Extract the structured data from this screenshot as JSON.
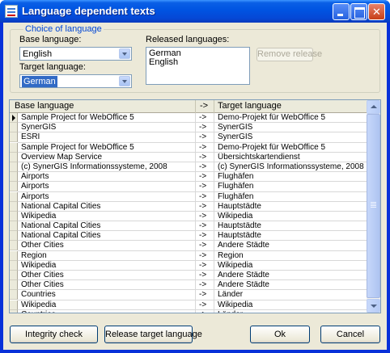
{
  "window": {
    "title": "Language dependent texts",
    "controls": {
      "minimize": "minimize",
      "maximize": "maximize",
      "close": "✕"
    }
  },
  "choice": {
    "legend": "Choice of language",
    "base_label": "Base language:",
    "base_value": "English",
    "target_label": "Target language:",
    "target_value": "German",
    "released_label": "Released languages:",
    "released": [
      "German",
      "English"
    ],
    "remove_release": "Remove release"
  },
  "grid": {
    "columns": [
      "Base language",
      "->",
      "Target language"
    ],
    "rows": [
      [
        "Sample Project for WebOffice 5",
        "->",
        "Demo-Projekt für WebOffice 5"
      ],
      [
        "SynerGIS",
        "->",
        "SynerGIS"
      ],
      [
        "ESRI",
        "->",
        "SynerGIS"
      ],
      [
        "Sample Project for WebOffice 5",
        "->",
        "Demo-Projekt für WebOffice 5"
      ],
      [
        "Overview Map Service",
        "->",
        "Übersichtskartendienst"
      ],
      [
        "(c) SynerGIS Informationssysteme, 2008",
        "->",
        "(c) SynerGIS Informationssysteme, 2008"
      ],
      [
        "Airports",
        "->",
        "Flughäfen"
      ],
      [
        "Airports",
        "->",
        "Flughäfen"
      ],
      [
        "Airports",
        "->",
        "Flughäfen"
      ],
      [
        "National Capital Cities",
        "->",
        "Hauptstädte"
      ],
      [
        "Wikipedia",
        "->",
        "Wikipedia"
      ],
      [
        "National Capital Cities",
        "->",
        "Hauptstädte"
      ],
      [
        "National Capital Cities",
        "->",
        "Hauptstädte"
      ],
      [
        "Other Cities",
        "->",
        "Andere Städte"
      ],
      [
        "Region",
        "->",
        "Region"
      ],
      [
        "Wikipedia",
        "->",
        "Wikipedia"
      ],
      [
        "Other Cities",
        "->",
        "Andere Städte"
      ],
      [
        "Other Cities",
        "->",
        "Andere Städte"
      ],
      [
        "Countries",
        "->",
        "Länder"
      ],
      [
        "Wikipedia",
        "->",
        "Wikipedia"
      ],
      [
        "Countries",
        "->",
        "Länder"
      ]
    ]
  },
  "buttons": {
    "integrity": "Integrity check",
    "release": "Release target language",
    "ok": "Ok",
    "cancel": "Cancel"
  },
  "colors": {
    "titlebar": "#0053e1",
    "dialog_bg": "#ece9d8",
    "legend_text": "#0046d5",
    "selection": "#316ac5"
  }
}
